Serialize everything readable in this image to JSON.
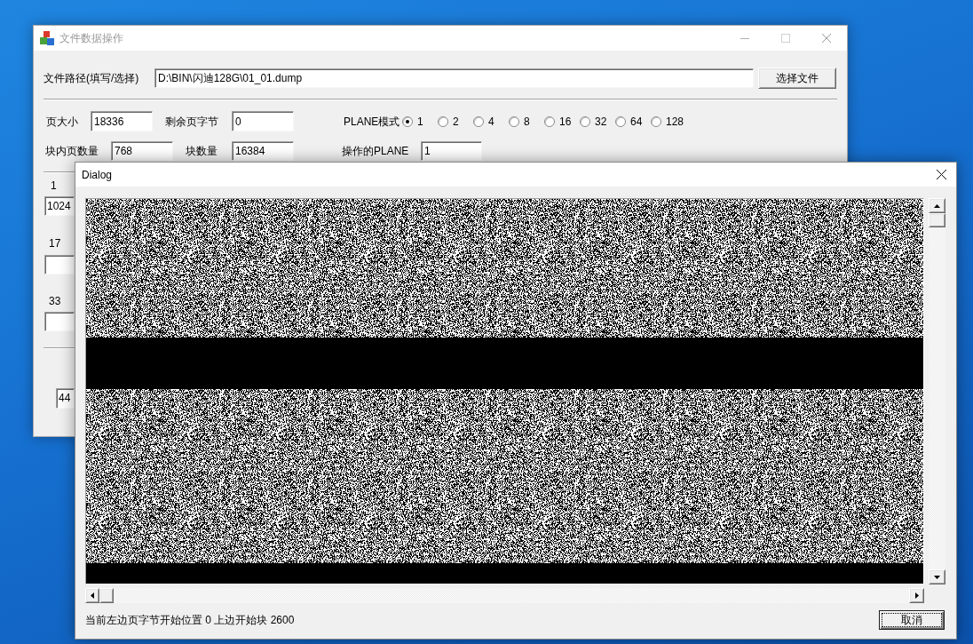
{
  "main_window": {
    "title": "文件数据操作",
    "file_path": {
      "label": "文件路径(填写/选择)",
      "value": "D:\\BIN\\闪迪128G\\01_01.dump",
      "button": "选择文件"
    },
    "page_fields": [
      {
        "label": "页大小",
        "value": "18336"
      },
      {
        "label": "剩余页字节",
        "value": "0"
      }
    ],
    "plane_mode": {
      "label": "PLANE模式",
      "options": [
        {
          "label": "1",
          "selected": true
        },
        {
          "label": "2",
          "selected": false
        },
        {
          "label": "4",
          "selected": false
        },
        {
          "label": "8",
          "selected": false
        },
        {
          "label": "16",
          "selected": false
        },
        {
          "label": "32",
          "selected": false
        },
        {
          "label": "64",
          "selected": false
        },
        {
          "label": "128",
          "selected": false
        }
      ]
    },
    "block_fields": [
      {
        "label": "块内页数量",
        "value": "768"
      },
      {
        "label": "块数量",
        "value": "16384"
      },
      {
        "label": "操作的PLANE",
        "value": "1"
      }
    ],
    "byte_fields": [
      {
        "label": "1",
        "value": "1024"
      },
      {
        "label": "17"
      },
      {
        "label": "33"
      }
    ],
    "lower_field": {
      "value": "44"
    }
  },
  "dialog": {
    "title": "Dialog",
    "status": "当前左边页字节开始位置 0 上边开始块 2600",
    "cancel_button": "取消"
  }
}
